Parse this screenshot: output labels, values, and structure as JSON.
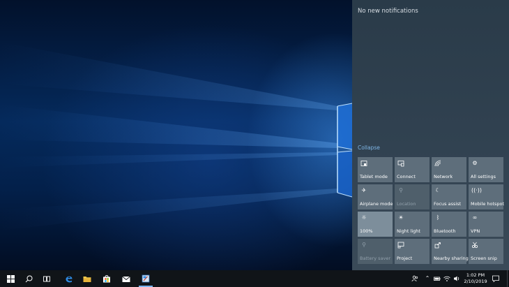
{
  "action_center": {
    "no_notifications": "No new notifications",
    "collapse": "Collapse",
    "tiles": [
      {
        "label": "Tablet mode",
        "icon": "tablet-mode-icon",
        "state": "normal"
      },
      {
        "label": "Connect",
        "icon": "connect-icon",
        "state": "normal"
      },
      {
        "label": "Network",
        "icon": "network-icon",
        "state": "normal"
      },
      {
        "label": "All settings",
        "icon": "gear-icon",
        "state": "normal"
      },
      {
        "label": "Airplane mode",
        "icon": "airplane-icon",
        "state": "normal"
      },
      {
        "label": "Location",
        "icon": "location-icon",
        "state": "disabled"
      },
      {
        "label": "Focus assist",
        "icon": "moon-icon",
        "state": "normal"
      },
      {
        "label": "Mobile hotspot",
        "icon": "hotspot-icon",
        "state": "normal"
      },
      {
        "label": "100%",
        "icon": "brightness-icon",
        "state": "active"
      },
      {
        "label": "Night light",
        "icon": "night-light-icon",
        "state": "normal"
      },
      {
        "label": "Bluetooth",
        "icon": "bluetooth-icon",
        "state": "normal"
      },
      {
        "label": "VPN",
        "icon": "vpn-icon",
        "state": "normal"
      },
      {
        "label": "Battery saver",
        "icon": "battery-saver-icon",
        "state": "disabled"
      },
      {
        "label": "Project",
        "icon": "project-icon",
        "state": "normal"
      },
      {
        "label": "Nearby sharing",
        "icon": "nearby-sharing-icon",
        "state": "normal"
      },
      {
        "label": "Screen snip",
        "icon": "screen-snip-icon",
        "state": "normal"
      }
    ]
  },
  "taskbar": {
    "time": "1:02 PM",
    "date": "2/10/2019",
    "accent": "#7ab4f0"
  }
}
